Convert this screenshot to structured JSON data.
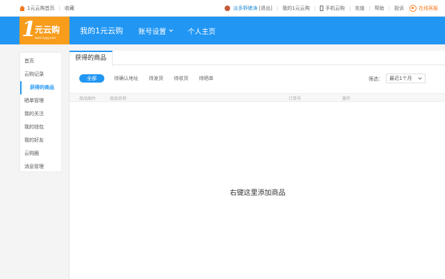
{
  "topbar": {
    "home": "1元云购首页",
    "favorite": "收藏",
    "username": "淡多野猪涛",
    "logout": "[退出]",
    "my_account": "我的1元云购",
    "mobile": "手机云购",
    "recharge": "充值",
    "help": "帮助",
    "complaint": "投诉",
    "service": "在线客服"
  },
  "logo": {
    "number": "1",
    "brand": "元云购",
    "url": "www.1yyg.com"
  },
  "nav": {
    "my": "我的1元云购",
    "account_settings": "账号设置",
    "homepage": "个人主页"
  },
  "sidebar": {
    "items": [
      {
        "label": "首页"
      },
      {
        "label": "云购记录"
      },
      {
        "label": "获得的商品"
      },
      {
        "label": "晒单管理"
      },
      {
        "label": "我的关注"
      },
      {
        "label": "我的钱包"
      },
      {
        "label": "我的好友"
      },
      {
        "label": "云购圈"
      },
      {
        "label": "消息管理"
      }
    ]
  },
  "main": {
    "tab": "获得的商品",
    "filters": [
      "全部",
      "待确认地址",
      "待发货",
      "待收货",
      "待晒单"
    ],
    "sort_label": "筛选：",
    "sort_value": "最近1个月",
    "columns": [
      "商品图片",
      "商品名称",
      "订单号",
      "操作"
    ],
    "empty_text": "右键这里添加商品"
  },
  "colors": {
    "accent": "#2196f3",
    "brand_orange": "#f89c1c"
  }
}
